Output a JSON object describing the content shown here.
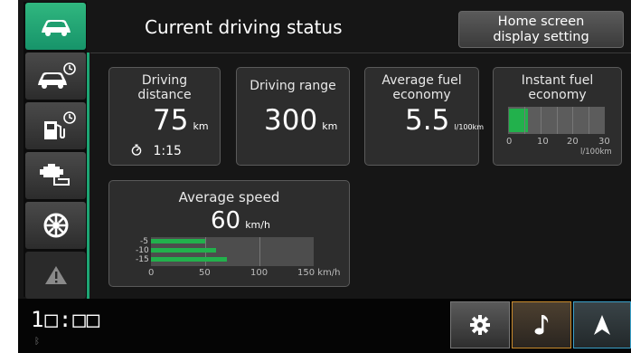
{
  "header": {
    "title": "Current driving status",
    "home_button_line1": "Home screen",
    "home_button_line2": "display setting"
  },
  "sidebar": {
    "items": [
      {
        "icon": "car-icon",
        "active": true
      },
      {
        "icon": "car-history-icon",
        "active": false
      },
      {
        "icon": "fuel-history-icon",
        "active": false
      },
      {
        "icon": "engine-info-icon",
        "active": false
      },
      {
        "icon": "tire-icon",
        "active": false
      },
      {
        "icon": "warning-icon",
        "active": false
      }
    ]
  },
  "cards": {
    "driving_distance": {
      "label_line1": "Driving",
      "label_line2": "distance",
      "value": "75",
      "unit": "km",
      "time": "1:15"
    },
    "driving_range": {
      "label": "Driving range",
      "value": "300",
      "unit": "km"
    },
    "average_fuel": {
      "label_line1": "Average fuel",
      "label_line2": "economy",
      "value": "5.5",
      "unit": "l/100km"
    },
    "instant_fuel": {
      "label_line1": "Instant fuel",
      "label_line2": "economy",
      "level": 0.2,
      "ticks": [
        "0",
        "10",
        "20",
        "30"
      ],
      "unit": "l/100km"
    },
    "average_speed": {
      "label": "Average speed",
      "value": "60",
      "unit": "km/h",
      "bars": [
        {
          "label": "-5",
          "value": 50
        },
        {
          "label": "-10",
          "value": 60
        },
        {
          "label": "-15",
          "value": 70
        }
      ],
      "ticks": [
        "0",
        "50",
        "100",
        "150 km/h"
      ]
    }
  },
  "bottom": {
    "clock": "1□:□□",
    "buttons": [
      "settings-icon",
      "music-note-icon",
      "navigation-icon"
    ]
  },
  "colors": {
    "accent_green": "#22b14c",
    "active_tab": "#1ea574",
    "music_border": "#c98a2c",
    "nav_border": "#3aa0c8"
  }
}
